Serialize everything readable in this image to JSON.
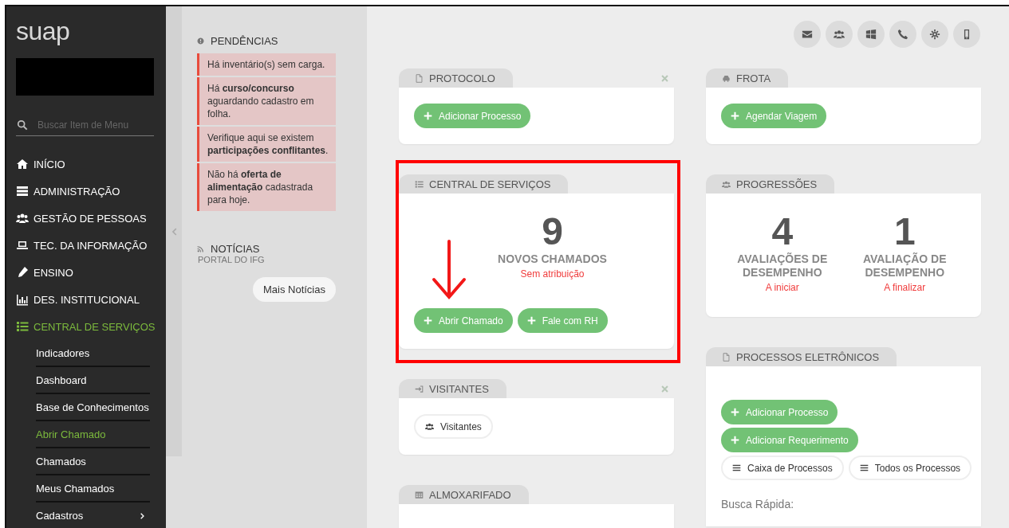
{
  "sidebar": {
    "logo": "suap",
    "search": {
      "placeholder": "Buscar Item de Menu"
    },
    "menu": [
      {
        "label": "INÍCIO",
        "selected": false
      },
      {
        "label": "ADMINISTRAÇÃO",
        "selected": false
      },
      {
        "label": "GESTÃO DE PESSOAS",
        "selected": false
      },
      {
        "label": "TEC. DA INFORMAÇÃO",
        "selected": false
      },
      {
        "label": "ENSINO",
        "selected": false
      },
      {
        "label": "DES. INSTITUCIONAL",
        "selected": false
      },
      {
        "label": "CENTRAL DE SERVIÇOS",
        "selected": true,
        "expanded": true,
        "children": [
          {
            "label": "Indicadores",
            "selected": false,
            "has_submenu": false
          },
          {
            "label": "Dashboard",
            "selected": false,
            "has_submenu": false
          },
          {
            "label": "Base de Conhecimentos",
            "selected": false,
            "has_submenu": false
          },
          {
            "label": "Abrir Chamado",
            "selected": true,
            "has_submenu": false
          },
          {
            "label": "Chamados",
            "selected": false,
            "has_submenu": false
          },
          {
            "label": "Meus Chamados",
            "selected": false,
            "has_submenu": false
          },
          {
            "label": "Cadastros",
            "selected": false,
            "has_submenu": true
          }
        ]
      }
    ]
  },
  "pendencias": {
    "title": "PENDÊNCIAS",
    "items": [
      "Há inventário(s) sem carga.",
      "Há **curso/concurso** aguardando cadastro em folha.",
      "Verifique aqui se existem **participações conflitantes**.",
      "Não há **oferta de alimentação** cadastrada para hoje."
    ]
  },
  "noticias": {
    "title": "NOTÍCIAS",
    "subtitle": "PORTAL DO IFG",
    "button": "Mais Notícias"
  },
  "columns": [
    [
      {
        "title": "PROTOCOLO",
        "closable": true,
        "highlighted": false,
        "buttons": [
          {
            "label": "Adicionar Processo",
            "kind": "primary"
          }
        ]
      },
      {
        "title": "CENTRAL DE SERVIÇOS",
        "closable": false,
        "highlighted": true,
        "stats": [
          {
            "value": "9",
            "label": "NOVOS CHAMADOS",
            "note": "Sem atribuição"
          }
        ],
        "buttons": [
          {
            "label": "Abrir Chamado",
            "kind": "primary"
          },
          {
            "label": "Fale com RH",
            "kind": "primary"
          }
        ]
      },
      {
        "title": "VISITANTES",
        "closable": true,
        "highlighted": false,
        "buttons": [
          {
            "label": "Visitantes",
            "kind": "people"
          }
        ]
      },
      {
        "title": "ALMOXARIFADO",
        "closable": false,
        "highlighted": false
      }
    ],
    [
      {
        "title": "FROTA",
        "closable": false,
        "highlighted": false,
        "buttons": [
          {
            "label": "Agendar Viagem",
            "kind": "primary"
          }
        ]
      },
      {
        "title": "PROGRESSÕES",
        "closable": false,
        "highlighted": false,
        "stats": [
          {
            "value": "4",
            "label": "AVALIAÇÕES DE DESEMPENHO",
            "note": "A iniciar"
          },
          {
            "value": "1",
            "label": "AVALIAÇÃO DE DESEMPENHO",
            "note": "A finalizar"
          }
        ]
      },
      {
        "title": "PROCESSOS ELETRÔNICOS",
        "closable": false,
        "highlighted": false,
        "buttons": [
          {
            "label": "Adicionar Processo",
            "kind": "primary"
          },
          {
            "label": "Adicionar Requerimento",
            "kind": "primary"
          },
          {
            "label": "Caixa de Processos",
            "kind": "list"
          },
          {
            "label": "Todos os Processos",
            "kind": "list"
          }
        ],
        "field_label": "Busca Rápida:"
      }
    ]
  ]
}
